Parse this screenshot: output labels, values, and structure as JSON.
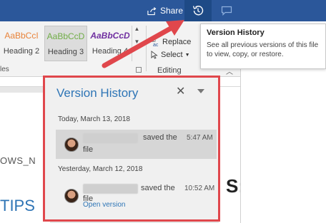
{
  "titlebar": {
    "share_label": "Share"
  },
  "ribbon": {
    "styles": [
      {
        "sample": "AaBbCcI",
        "name": "Heading 2",
        "color": "#e8833a"
      },
      {
        "sample": "AaBbCcD",
        "name": "Heading 3",
        "color": "#70ad47"
      },
      {
        "sample": "AaBbCcD",
        "name": "Heading 4",
        "color": "#7030a0"
      }
    ],
    "styles_group_label": "les",
    "editing": {
      "replace_label": "Replace",
      "select_label": "Select",
      "group_label": "Editing"
    }
  },
  "tooltip": {
    "title": "Version History",
    "text": "See all previous versions of this file to view, copy, or restore."
  },
  "document": {
    "text_1": "OWS_N",
    "text_2": "TIPS",
    "large_letter": "S:"
  },
  "version_history": {
    "title": "Version History",
    "groups": [
      {
        "date": "Today, March 13, 2018",
        "entry": {
          "saved_text": "saved the",
          "file_text": "file",
          "time": "5:47 AM"
        }
      },
      {
        "date": "Yesterday, March 12, 2018",
        "entry": {
          "saved_text": "saved the",
          "file_text": "file",
          "time": "10:52 AM",
          "action": "Open version"
        }
      }
    ]
  },
  "colors": {
    "accent": "#2b579a",
    "panel_border": "#e0474c",
    "link": "#2e75b6"
  }
}
